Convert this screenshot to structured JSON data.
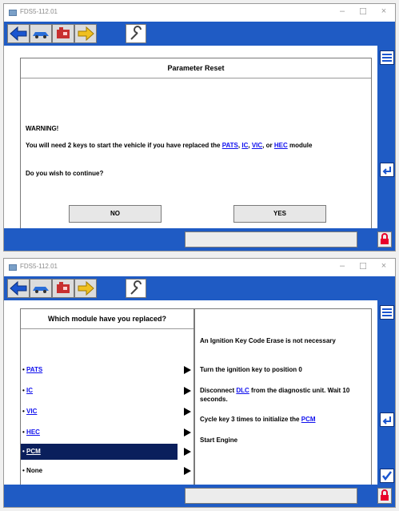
{
  "app": {
    "window_title": "FDS5-112.01"
  },
  "top_window": {
    "dialog_title": "Parameter Reset",
    "warning_heading": "WARNING!",
    "message_part1": "You will need 2 keys to start the vehicle if you have replaced the",
    "links": [
      "PATS",
      "IC",
      "VIC",
      "HEC"
    ],
    "sep1": ",",
    "sep2": ",",
    "sep3": ", or",
    "message_part2": "module",
    "question": "Do you wish to continue?",
    "no_label": "NO",
    "yes_label": "YES"
  },
  "bottom_window": {
    "list_title": "Which module have you replaced?",
    "modules": [
      {
        "label": "PATS",
        "link": true
      },
      {
        "label": "IC",
        "link": true
      },
      {
        "label": "VIC",
        "link": true
      },
      {
        "label": "HEC",
        "link": true
      },
      {
        "label": "PCM",
        "link": true,
        "selected": true
      },
      {
        "label": "None",
        "link": false
      }
    ],
    "bullet": "•",
    "info_line1": "An Ignition Key Code Erase is not necessary",
    "info_line2": "Turn the ignition key to position 0",
    "info_disconnect_pre": "Disconnect",
    "info_dlc": "DLC",
    "info_disconnect_post": "from the diagnostic unit. Wait 10 seconds.",
    "info_cycle_pre": "Cycle key 3 times to initialize the",
    "info_pcm": "PCM",
    "info_start": "Start Engine"
  },
  "icons": {
    "toolbar": [
      "back-arrow-icon",
      "car-icon",
      "engine-icon",
      "forward-arrow-icon",
      "wrench-icon"
    ],
    "sidebar": [
      "list-icon",
      "return-icon",
      "checkmark-icon"
    ],
    "status": "lock-icon"
  },
  "colors": {
    "toolbar_blue": "#1f5bc4",
    "selected_row": "#0a1f5c",
    "link": "#1010ee",
    "lock_red": "#e8002a"
  }
}
